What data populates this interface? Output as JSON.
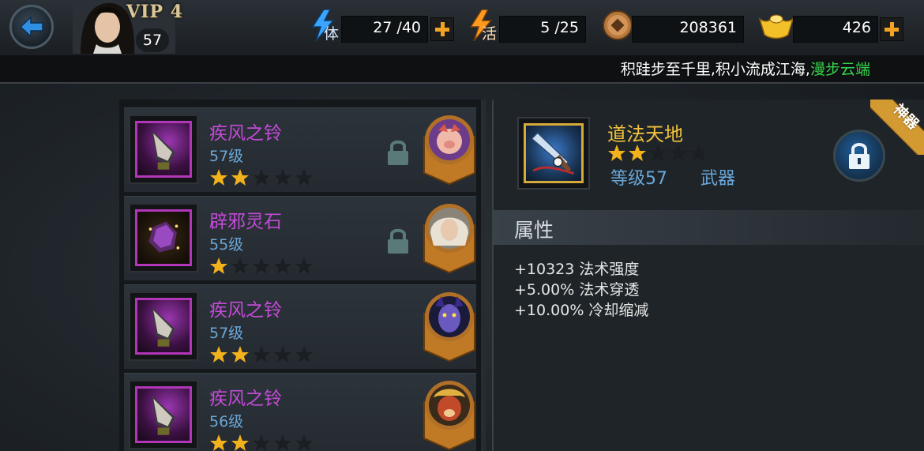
{
  "player": {
    "vip": "VIP 4",
    "level": "57"
  },
  "resources": {
    "stamina": {
      "label": "体",
      "value": "27 /40"
    },
    "vitality": {
      "label": "活",
      "value": "5 /25"
    },
    "coins": {
      "value": "208361"
    },
    "gold": {
      "value": "426"
    }
  },
  "ticker": {
    "text": "积跬步至千里,积小流成江海,",
    "highlight": "漫步云端"
  },
  "items": [
    {
      "name": "疾风之铃",
      "level": "57级",
      "stars": 2,
      "icon": "bell-icon",
      "hero": "pig-hero-portrait",
      "locked": true
    },
    {
      "name": "辟邪灵石",
      "level": "55级",
      "stars": 1,
      "icon": "spirit-stone-icon",
      "hero": "white-hair-hero-portrait",
      "locked": true
    },
    {
      "name": "疾风之铃",
      "level": "57级",
      "stars": 2,
      "icon": "bell-icon",
      "hero": "demon-hero-portrait",
      "locked": false
    },
    {
      "name": "疾风之铃",
      "level": "56级",
      "stars": 2,
      "icon": "bell-icon",
      "hero": "monkey-king-hero-portrait",
      "locked": false
    }
  ],
  "detail": {
    "name": "道法天地",
    "stars": 2,
    "level": "等级57",
    "type": "武器",
    "ribbon": "神器",
    "section_title": "属性",
    "attributes": [
      "+10323 法术强度",
      "+5.00% 法术穿透",
      "+10.00% 冷却缩减"
    ]
  },
  "colors": {
    "accent_orange": "#f2a321",
    "item_purple": "#c44bd8",
    "level_blue": "#6aa7d8",
    "gold_name": "#f2c23c",
    "green_text": "#37d64a"
  }
}
